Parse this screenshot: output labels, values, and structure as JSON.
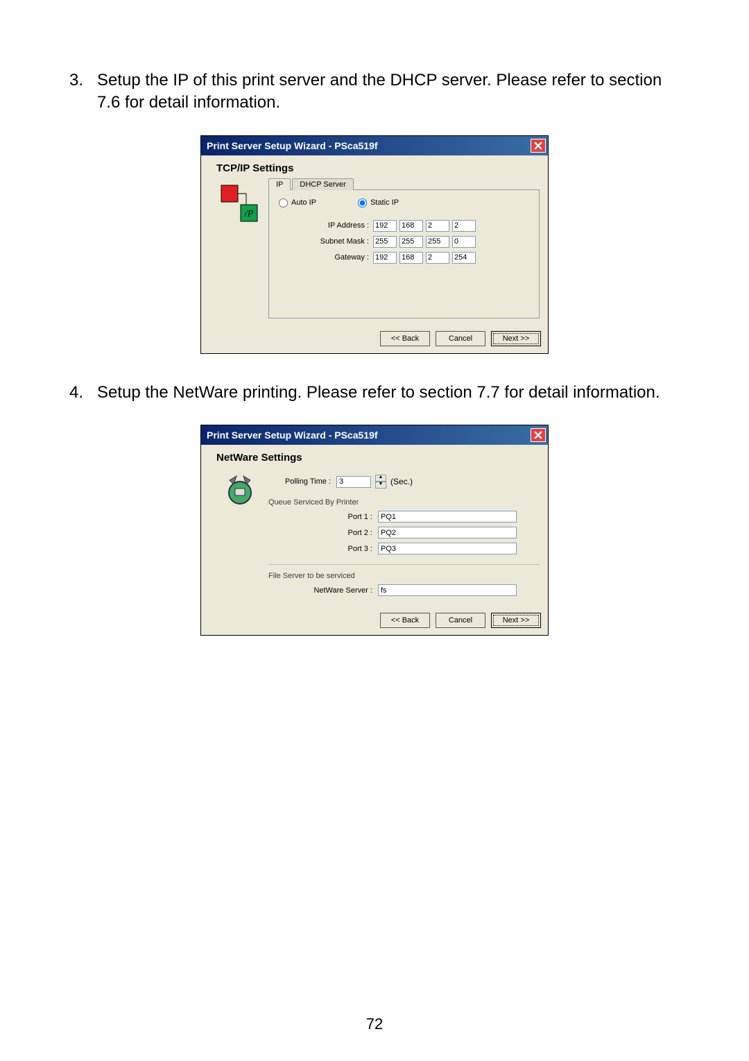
{
  "step3": {
    "number": "3.",
    "text": "Setup the IP of this print server and the DHCP server. Please refer to section 7.6 for detail information."
  },
  "step4": {
    "number": "4.",
    "text": "Setup the NetWare printing. Please refer to section 7.7 for detail information."
  },
  "dialog1": {
    "title": "Print Server Setup Wizard - PSca519f",
    "section": "TCP/IP Settings",
    "tabs": {
      "ip": "IP",
      "dhcp": "DHCP Server"
    },
    "radio_auto": "Auto IP",
    "radio_static": "Static IP",
    "labels": {
      "ip": "IP Address :",
      "mask": "Subnet Mask :",
      "gw": "Gateway :"
    },
    "ip": [
      "192",
      "168",
      "2",
      "2"
    ],
    "mask": [
      "255",
      "255",
      "255",
      "0"
    ],
    "gw": [
      "192",
      "168",
      "2",
      "254"
    ],
    "buttons": {
      "back": "<< Back",
      "cancel": "Cancel",
      "next": "Next >>"
    }
  },
  "dialog2": {
    "title": "Print Server Setup Wizard - PSca519f",
    "section": "NetWare Settings",
    "polling_label": "Polling Time :",
    "polling_value": "3",
    "polling_unit": "(Sec.)",
    "queue_group": "Queue Serviced By Printer",
    "ports": {
      "p1l": "Port 1 :",
      "p1v": "PQ1",
      "p2l": "Port 2 :",
      "p2v": "PQ2",
      "p3l": "Port 3 :",
      "p3v": "PQ3"
    },
    "fs_group": "File Server to be serviced",
    "nwserver_label": "NetWare Server :",
    "nwserver_value": "fs",
    "buttons": {
      "back": "<< Back",
      "cancel": "Cancel",
      "next": "Next >>"
    }
  },
  "page_number": "72"
}
